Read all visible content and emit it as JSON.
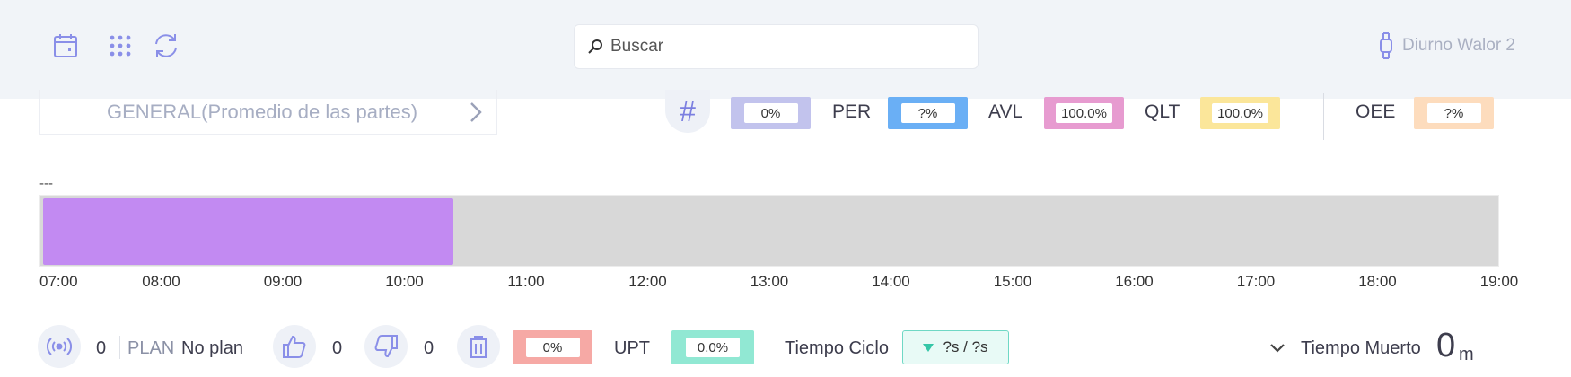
{
  "header": {
    "search_placeholder": "Buscar",
    "user_name": "Diurno Walor 2",
    "icons": [
      "calendar-icon",
      "grid-apps-icon",
      "refresh-icon",
      "search-icon",
      "watch-icon"
    ]
  },
  "filter": {
    "part_label": "GENERAL(Promedio de las partes)",
    "hash_symbol": "#",
    "metrics": [
      {
        "key": "count",
        "label": "",
        "value": "0%",
        "color": "#c2c3ed"
      },
      {
        "key": "per",
        "label": "PER",
        "value": "?%",
        "color": "#6aaff5"
      },
      {
        "key": "avl",
        "label": "AVL",
        "value": "100.0%",
        "color": "#e79bd0"
      },
      {
        "key": "qlt",
        "label": "QLT",
        "value": "100.0%",
        "color": "#fbe69a"
      },
      {
        "key": "oee",
        "label": "OEE",
        "value": "?%",
        "color": "#fddcbd"
      }
    ]
  },
  "timeline": {
    "label": "---",
    "start": "07:00",
    "end": "19:00",
    "progress_until": "10:25",
    "fill_color": "#c28af2",
    "ticks": [
      "07:00",
      "08:00",
      "09:00",
      "10:00",
      "11:00",
      "12:00",
      "13:00",
      "14:00",
      "15:00",
      "16:00",
      "17:00",
      "18:00",
      "19:00"
    ]
  },
  "footer": {
    "signal_count": "0",
    "plan_label": "PLAN",
    "plan_value": "No plan",
    "good_count": "0",
    "bad_count": "0",
    "scrap_value": "0%",
    "scrap_color": "#f6a9a5",
    "upt_label": "UPT",
    "upt_value": "0.0%",
    "upt_color": "#91e8d3",
    "cycle_label": "Tiempo Ciclo",
    "cycle_value": "?s / ?s",
    "dead_label": "Tiempo Muerto",
    "dead_value": "0",
    "dead_unit": "m"
  }
}
